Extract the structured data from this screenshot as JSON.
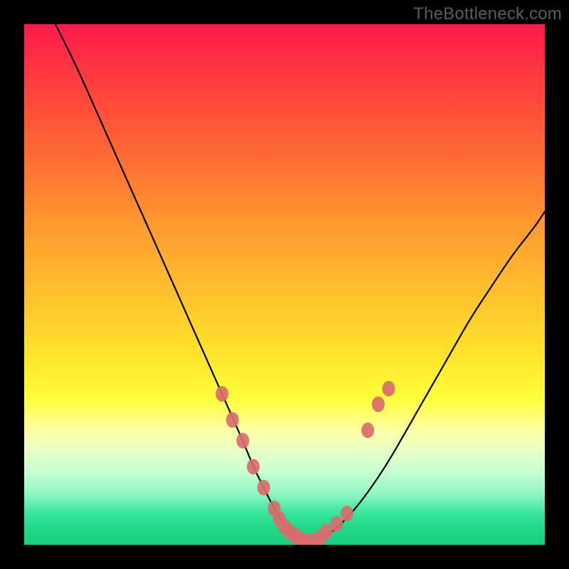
{
  "watermark": "TheBottleneck.com",
  "chart_data": {
    "type": "line",
    "title": "",
    "xlabel": "",
    "ylabel": "",
    "xlim": [
      0,
      100
    ],
    "ylim": [
      0,
      100
    ],
    "series": [
      {
        "name": "bottleneck-curve",
        "x": [
          6,
          10,
          14,
          18,
          22,
          26,
          30,
          34,
          38,
          42,
          44,
          46,
          48,
          50,
          52,
          54,
          56,
          58,
          62,
          66,
          70,
          74,
          78,
          82,
          86,
          90,
          94,
          98,
          100
        ],
        "y": [
          100,
          92,
          83,
          74,
          65,
          56,
          47,
          38,
          29,
          20,
          15,
          11,
          7,
          4,
          1.5,
          0.7,
          0.7,
          1.5,
          5,
          10,
          16,
          23,
          30,
          37,
          44,
          50,
          56,
          61,
          64
        ]
      }
    ],
    "markers": {
      "name": "highlighted-range",
      "color": "#d96d6d",
      "points": [
        {
          "x": 38,
          "y": 29
        },
        {
          "x": 40,
          "y": 24
        },
        {
          "x": 42,
          "y": 20
        },
        {
          "x": 44,
          "y": 15
        },
        {
          "x": 46,
          "y": 11
        },
        {
          "x": 48,
          "y": 7
        },
        {
          "x": 49,
          "y": 5
        },
        {
          "x": 50,
          "y": 3.5
        },
        {
          "x": 51,
          "y": 2.5
        },
        {
          "x": 52,
          "y": 1.8
        },
        {
          "x": 53,
          "y": 1.0
        },
        {
          "x": 54,
          "y": 0.7
        },
        {
          "x": 55,
          "y": 0.7
        },
        {
          "x": 56,
          "y": 0.7
        },
        {
          "x": 57,
          "y": 1.5
        },
        {
          "x": 58,
          "y": 2.5
        },
        {
          "x": 60,
          "y": 4
        },
        {
          "x": 62,
          "y": 6
        },
        {
          "x": 66,
          "y": 22
        },
        {
          "x": 68,
          "y": 27
        },
        {
          "x": 70,
          "y": 30
        }
      ]
    }
  }
}
